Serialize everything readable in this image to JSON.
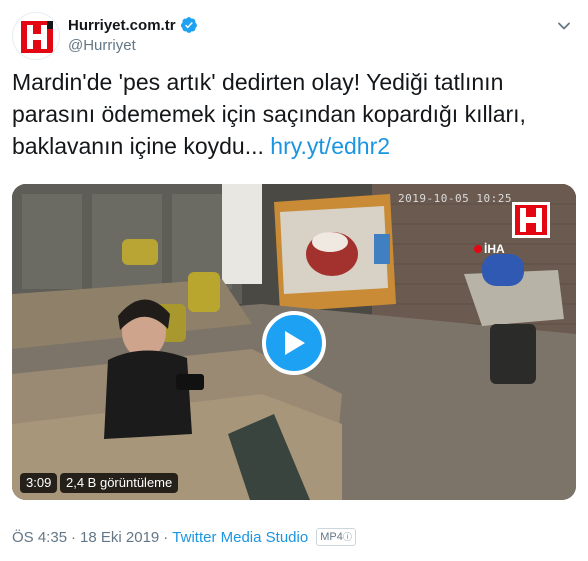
{
  "tweet": {
    "display_name": "Hurriyet.com.tr",
    "handle": "@Hurriyet",
    "verified": true,
    "avatar_letter": "H",
    "text_main": "Mardin'de 'pes artık' dedirten olay! Yediği tatlının parasını ödememek için saçından kopardığı kılları, baklavanın içine koydu... ",
    "link_text": "hry.yt/edhr2"
  },
  "video": {
    "camera_timestamp": "2019-10-05 10:25",
    "watermark_text": "İHA",
    "duration": "3:09",
    "views": "2,4 B görüntüleme"
  },
  "meta": {
    "time": "ÖS 4:35",
    "separator": "·",
    "date": "18 Eki 2019",
    "source": "Twitter Media Studio",
    "media_tag": "MP4"
  },
  "colors": {
    "brand_red": "#e30613",
    "link_blue": "#1b95e0",
    "play_blue": "#1da1f2",
    "secondary_text": "#657786"
  },
  "icons": {
    "verified": "verified-badge-icon",
    "caret": "chevron-down-icon",
    "play": "play-icon"
  }
}
